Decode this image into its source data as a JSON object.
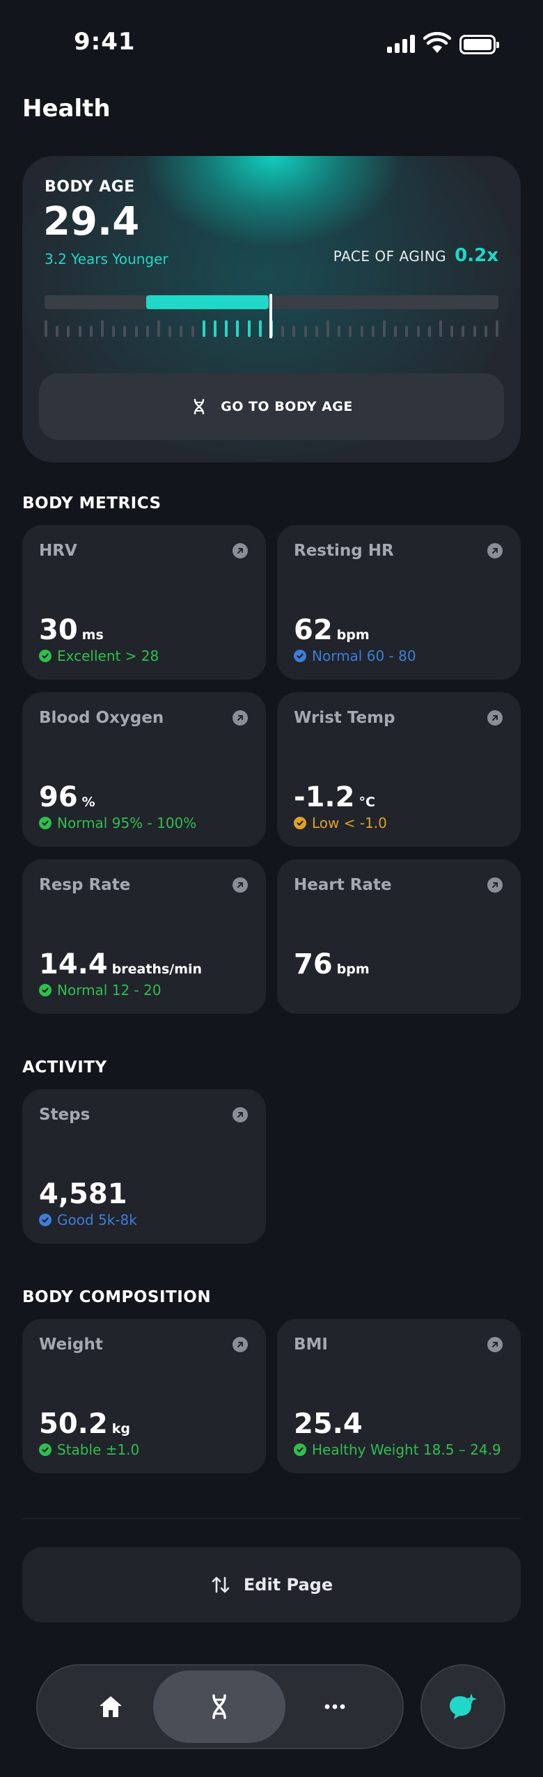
{
  "status_bar": {
    "time": "9:41"
  },
  "page_title": "Health",
  "body_age": {
    "label": "BODY AGE",
    "value": "29.4",
    "subtitle": "3.2 Years Younger",
    "pace_label": "PACE OF AGING",
    "pace_value": "0.2x",
    "button_label": "GO TO BODY AGE",
    "accent_color": "#20d8c7"
  },
  "sections": {
    "body_metrics": "BODY METRICS",
    "activity": "ACTIVITY",
    "body_composition": "BODY COMPOSITION"
  },
  "metrics": [
    {
      "title": "HRV",
      "value": "30",
      "unit": "ms",
      "status": "Excellent > 28",
      "status_color": "green"
    },
    {
      "title": "Resting HR",
      "value": "62",
      "unit": "bpm",
      "status": "Normal 60 - 80",
      "status_color": "blue"
    },
    {
      "title": "Blood Oxygen",
      "value": "96",
      "unit": "%",
      "status": "Normal 95% - 100%",
      "status_color": "green"
    },
    {
      "title": "Wrist Temp",
      "value": "-1.2",
      "unit": "°C",
      "status": "Low < -1.0",
      "status_color": "orange"
    },
    {
      "title": "Resp Rate",
      "value": "14.4",
      "unit": "breaths/min",
      "status": "Normal 12 - 20",
      "status_color": "green"
    },
    {
      "title": "Heart Rate",
      "value": "76",
      "unit": "bpm",
      "status": "",
      "status_color": ""
    }
  ],
  "activity": [
    {
      "title": "Steps",
      "value": "4,581",
      "unit": "",
      "status": "Good 5k-8k",
      "status_color": "blue"
    }
  ],
  "body_composition": [
    {
      "title": "Weight",
      "value": "50.2",
      "unit": "kg",
      "status": "Stable ±1.0",
      "status_color": "green"
    },
    {
      "title": "BMI",
      "value": "25.4",
      "unit": "",
      "status": "Healthy Weight 18.5 – 24.9",
      "status_color": "green"
    }
  ],
  "edit_button": "Edit Page",
  "nav": {
    "items": [
      "home-icon",
      "dna-icon",
      "more-icon"
    ],
    "active": "dna-icon",
    "ai_button": "ai-chat-icon"
  }
}
